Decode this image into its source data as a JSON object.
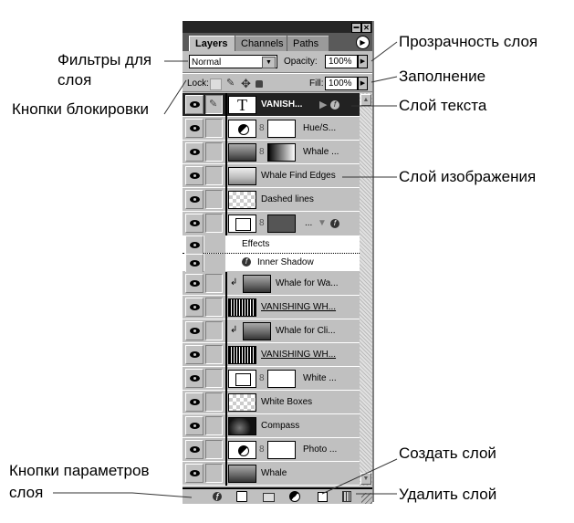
{
  "annotations": {
    "filters": [
      "Фильтры для",
      "слоя"
    ],
    "lock_buttons": "Кнопки блокировки",
    "opacity": "Прозрачность слоя",
    "fill": "Заполнение",
    "text_layer": "Слой текста",
    "image_layer": "Слой изображения",
    "create_layer": "Создать слой",
    "delete_layer": "Удалить слой",
    "layer_options": [
      "Кнопки параметров",
      "слоя"
    ]
  },
  "panel": {
    "window_buttons": {
      "minimize": "▬",
      "close": "✕"
    },
    "tabs": [
      {
        "label": "Layers",
        "active": true
      },
      {
        "label": "Channels",
        "active": false
      },
      {
        "label": "Paths",
        "active": false
      }
    ],
    "menu_icon": "▶",
    "blend_mode": "Normal",
    "opacity_label": "Opacity:",
    "opacity_value": "100%",
    "lock_label": "Lock:",
    "fill_label": "Fill:",
    "fill_value": "100%",
    "layers": [
      {
        "name": "VANISH...",
        "type": "text",
        "selected": true,
        "thumb": "T"
      },
      {
        "name": "Hue/S...",
        "type": "adjustment"
      },
      {
        "name": "Whale ...",
        "type": "photo-mask"
      },
      {
        "name": "Whale Find Edges",
        "type": "photo"
      },
      {
        "name": "Dashed lines",
        "type": "checker"
      },
      {
        "name": "...",
        "type": "shape-fx"
      },
      {
        "name": "Effects",
        "type": "effects-header"
      },
      {
        "name": "Inner Shadow",
        "type": "effect"
      },
      {
        "name": "Whale for Wa...",
        "type": "clipped-photo"
      },
      {
        "name": "VANISHING WH...",
        "type": "vw"
      },
      {
        "name": "Whale for  Cli...",
        "type": "clipped-photo"
      },
      {
        "name": "VANISHING WH...",
        "type": "vw"
      },
      {
        "name": "White ...",
        "type": "white-mask"
      },
      {
        "name": "White Boxes",
        "type": "checker"
      },
      {
        "name": "Compass",
        "type": "dark"
      },
      {
        "name": "Photo ...",
        "type": "adjustment"
      },
      {
        "name": "Whale",
        "type": "photo"
      }
    ],
    "footer_icons": [
      "layer-style-icon",
      "add-mask-icon",
      "new-group-icon",
      "adjustment-layer-icon",
      "new-layer-icon",
      "trash-icon"
    ]
  }
}
